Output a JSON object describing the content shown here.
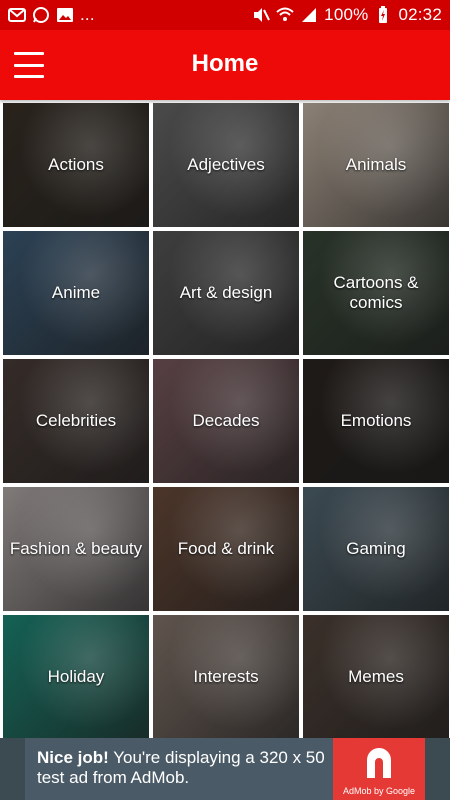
{
  "status_bar": {
    "battery": "100%",
    "time": "02:32",
    "left_icons": [
      "mail-icon",
      "whatsapp-icon",
      "gallery-icon"
    ],
    "overflow": "..."
  },
  "app_bar": {
    "title": "Home"
  },
  "categories": [
    {
      "label": "Actions",
      "color": "#3b3228"
    },
    {
      "label": "Adjectives",
      "color": "#6b6b6b"
    },
    {
      "label": "Animals",
      "color": "#c9b9a8"
    },
    {
      "label": "Anime",
      "color": "#3f5e7a"
    },
    {
      "label": "Art & design",
      "color": "#5a5a5a"
    },
    {
      "label": "Cartoons & comics",
      "color": "#3a4a3a"
    },
    {
      "label": "Celebrities",
      "color": "#4c3f3a"
    },
    {
      "label": "Decades",
      "color": "#7d5c60"
    },
    {
      "label": "Emotions",
      "color": "#2c2622"
    },
    {
      "label": "Fashion & beauty",
      "color": "#b8b0ae"
    },
    {
      "label": "Food & drink",
      "color": "#6d4d3c"
    },
    {
      "label": "Gaming",
      "color": "#556a75"
    },
    {
      "label": "Holiday",
      "color": "#1f8c7a"
    },
    {
      "label": "Interests",
      "color": "#8a7a70"
    },
    {
      "label": "Memes",
      "color": "#55463d"
    }
  ],
  "ad": {
    "bold": "Nice job!",
    "text": " You're displaying a 320 x 50 test ad from AdMob.",
    "logo_caption": "AdMob by Google"
  }
}
